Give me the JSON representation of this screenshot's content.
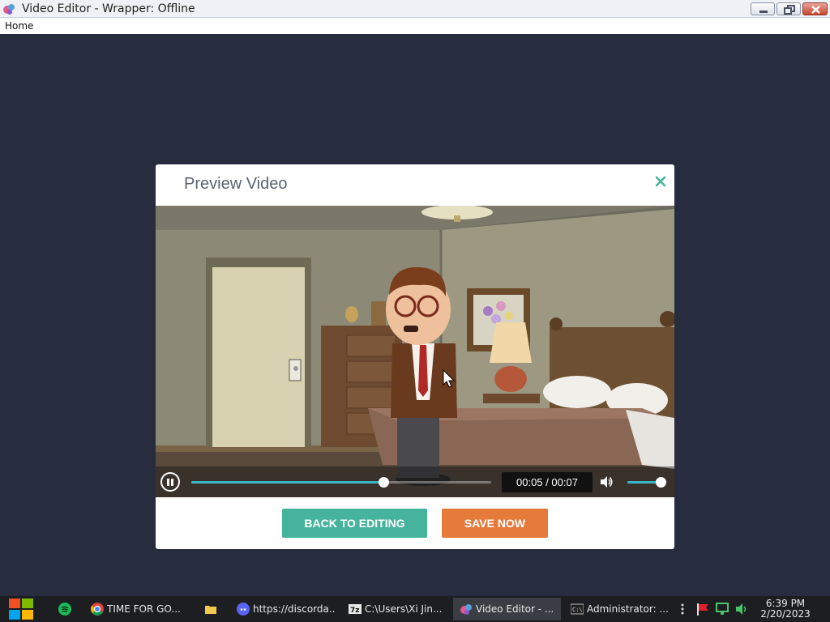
{
  "window": {
    "title": "Video Editor - Wrapper: Offline"
  },
  "menu": {
    "home": "Home"
  },
  "modal": {
    "title": "Preview Video",
    "close_glyph": "×",
    "player": {
      "state": "playing",
      "time_display": "00:05 / 00:07",
      "progress_fraction": 0.64,
      "volume_fraction": 0.85
    },
    "buttons": {
      "back": "BACK TO EDITING",
      "save": "SAVE NOW"
    }
  },
  "taskbar": {
    "items": [
      {
        "label": "TIME FOR GO...",
        "icon": "chrome-icon"
      },
      {
        "label": "https://discorda...",
        "icon": "discord-icon"
      },
      {
        "label": "C:\\Users\\Xi Jin...",
        "icon": "7zip-icon"
      },
      {
        "label": "Video Editor - ...",
        "icon": "wrapper-icon"
      },
      {
        "label": "Administrator: ...",
        "icon": "console-icon"
      }
    ],
    "clock_time": "6:39 PM",
    "clock_date": "2/20/2023"
  },
  "colors": {
    "accent_teal": "#46b39c",
    "accent_orange": "#e57a3b",
    "seek_fill": "#3ab7c5",
    "background": "#272d3e"
  }
}
